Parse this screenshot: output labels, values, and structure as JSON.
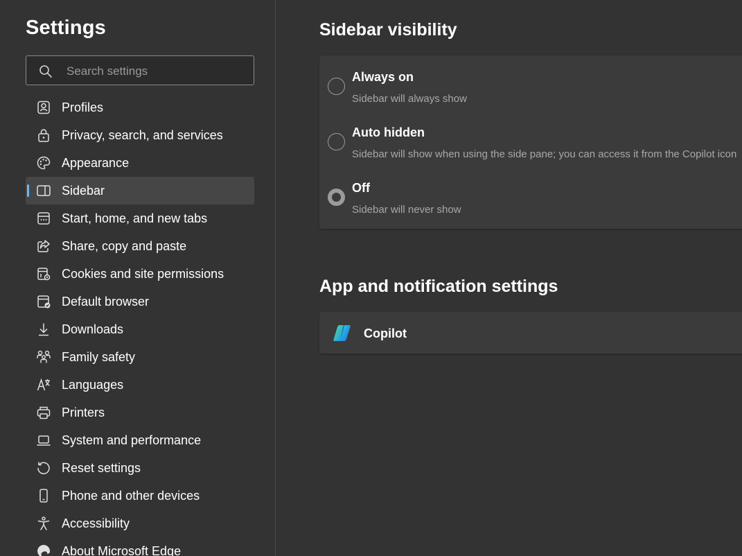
{
  "sidebar": {
    "title": "Settings",
    "search": {
      "placeholder": "Search settings",
      "value": ""
    },
    "items": [
      {
        "label": "Profiles",
        "icon": "profiles-icon"
      },
      {
        "label": "Privacy, search, and services",
        "icon": "lock-icon"
      },
      {
        "label": "Appearance",
        "icon": "palette-icon"
      },
      {
        "label": "Sidebar",
        "icon": "sidebar-icon",
        "selected": true
      },
      {
        "label": "Start, home, and new tabs",
        "icon": "start-page-icon"
      },
      {
        "label": "Share, copy and paste",
        "icon": "share-icon"
      },
      {
        "label": "Cookies and site permissions",
        "icon": "cookies-permissions-icon"
      },
      {
        "label": "Default browser",
        "icon": "default-browser-icon"
      },
      {
        "label": "Downloads",
        "icon": "download-icon"
      },
      {
        "label": "Family safety",
        "icon": "family-icon"
      },
      {
        "label": "Languages",
        "icon": "languages-icon"
      },
      {
        "label": "Printers",
        "icon": "printer-icon"
      },
      {
        "label": "System and performance",
        "icon": "laptop-icon"
      },
      {
        "label": "Reset settings",
        "icon": "reset-icon"
      },
      {
        "label": "Phone and other devices",
        "icon": "phone-icon"
      },
      {
        "label": "Accessibility",
        "icon": "accessibility-icon"
      },
      {
        "label": "About Microsoft Edge",
        "icon": "edge-logo-icon"
      }
    ],
    "accent_color": "#6cb8f6"
  },
  "main": {
    "visibility": {
      "title": "Sidebar visibility",
      "options": [
        {
          "label": "Always on",
          "description": "Sidebar will always show",
          "checked": false
        },
        {
          "label": "Auto hidden",
          "description": "Sidebar will show when using the side pane; you can access it from the Copilot icon",
          "checked": false
        },
        {
          "label": "Off",
          "description": "Sidebar will never show",
          "checked": true
        }
      ]
    },
    "apps": {
      "title": "App and notification settings",
      "items": [
        {
          "label": "Copilot",
          "icon": "copilot-icon"
        }
      ]
    }
  }
}
